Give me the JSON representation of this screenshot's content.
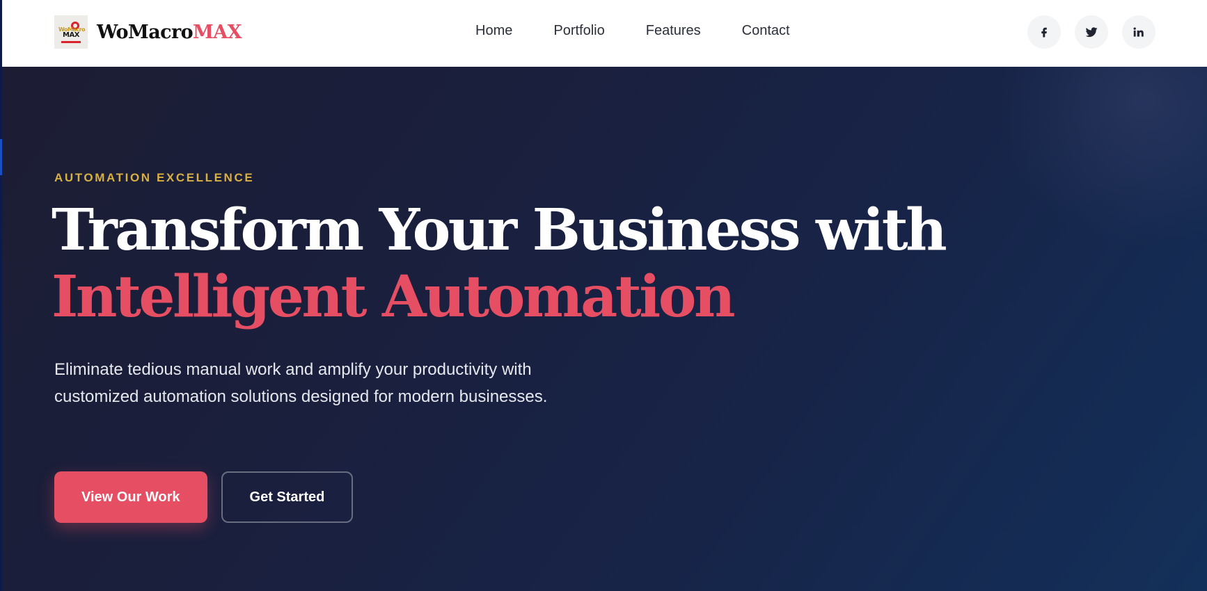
{
  "brand": {
    "name_main": "WoMacro",
    "name_accent": "MAX",
    "logo_text_top": "WoMacro",
    "logo_text_bottom": "MAX"
  },
  "nav": {
    "items": [
      {
        "label": "Home"
      },
      {
        "label": "Portfolio"
      },
      {
        "label": "Features"
      },
      {
        "label": "Contact"
      }
    ]
  },
  "socials": [
    {
      "icon": "facebook-icon"
    },
    {
      "icon": "twitter-icon"
    },
    {
      "icon": "linkedin-icon"
    }
  ],
  "hero": {
    "eyebrow": "AUTOMATION EXCELLENCE",
    "title_line1": "Transform Your Business with",
    "title_line2": "Intelligent Automation",
    "subtitle": "Eliminate tedious manual work and amplify your productivity with customized automation solutions designed for modern businesses.",
    "primary_cta": "View Our Work",
    "secondary_cta": "Get Started"
  },
  "colors": {
    "accent": "#e54e63",
    "eyebrow": "#d8b043",
    "hero_bg_start": "#1c1d33",
    "hero_bg_end": "#13305a"
  }
}
